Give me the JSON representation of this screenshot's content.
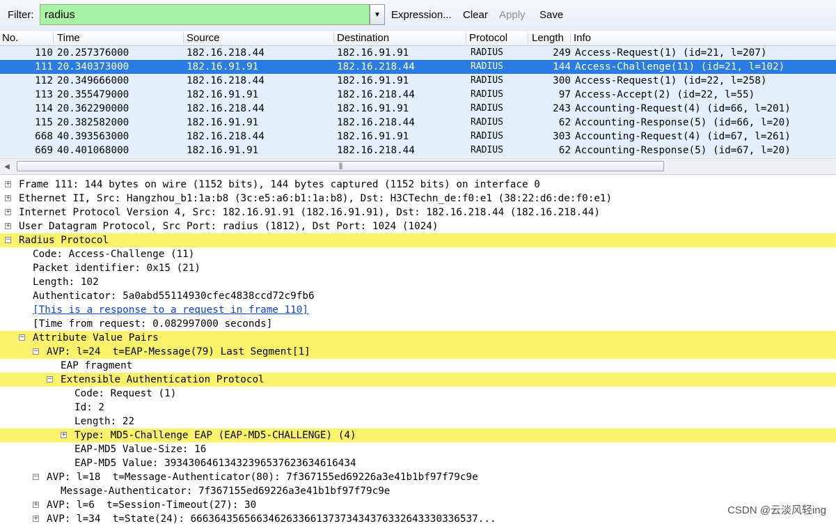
{
  "toolbar": {
    "filter_label": "Filter:",
    "filter_value": "radius",
    "expression_label": "Expression...",
    "clear_label": "Clear",
    "apply_label": "Apply",
    "save_label": "Save"
  },
  "columns": [
    "No.",
    "Time",
    "Source",
    "Destination",
    "Protocol",
    "Length",
    "Info"
  ],
  "packets": [
    {
      "no": "110",
      "time": "20.257376000",
      "src": "182.16.218.44",
      "dst": "182.16.91.91",
      "proto": "RADIUS",
      "len": "249",
      "info": "Access-Request(1) (id=21, l=207)"
    },
    {
      "no": "111",
      "time": "20.340373000",
      "src": "182.16.91.91",
      "dst": "182.16.218.44",
      "proto": "RADIUS",
      "len": "144",
      "info": "Access-Challenge(11) (id=21, l=102)"
    },
    {
      "no": "112",
      "time": "20.349666000",
      "src": "182.16.218.44",
      "dst": "182.16.91.91",
      "proto": "RADIUS",
      "len": "300",
      "info": "Access-Request(1) (id=22, l=258)"
    },
    {
      "no": "113",
      "time": "20.355479000",
      "src": "182.16.91.91",
      "dst": "182.16.218.44",
      "proto": "RADIUS",
      "len": "97",
      "info": "Access-Accept(2) (id=22, l=55)"
    },
    {
      "no": "114",
      "time": "20.362290000",
      "src": "182.16.218.44",
      "dst": "182.16.91.91",
      "proto": "RADIUS",
      "len": "243",
      "info": "Accounting-Request(4) (id=66, l=201)"
    },
    {
      "no": "115",
      "time": "20.382582000",
      "src": "182.16.91.91",
      "dst": "182.16.218.44",
      "proto": "RADIUS",
      "len": "62",
      "info": "Accounting-Response(5) (id=66, l=20)"
    },
    {
      "no": "668",
      "time": "40.393563000",
      "src": "182.16.218.44",
      "dst": "182.16.91.91",
      "proto": "RADIUS",
      "len": "303",
      "info": "Accounting-Request(4) (id=67, l=261)"
    },
    {
      "no": "669",
      "time": "40.401068000",
      "src": "182.16.91.91",
      "dst": "182.16.218.44",
      "proto": "RADIUS",
      "len": "62",
      "info": "Accounting-Response(5) (id=67, l=20)"
    }
  ],
  "selected_packet_no": "111",
  "details": [
    {
      "text": "Frame 111: 144 bytes on wire (1152 bits), 144 bytes captured (1152 bits) on interface 0",
      "toggle": "+"
    },
    {
      "text": "Ethernet II, Src: Hangzhou_b1:1a:b8 (3c:e5:a6:b1:1a:b8), Dst: H3CTechn_de:f0:e1 (38:22:d6:de:f0:e1)",
      "toggle": "+"
    },
    {
      "text": "Internet Protocol Version 4, Src: 182.16.91.91 (182.16.91.91), Dst: 182.16.218.44 (182.16.218.44)",
      "toggle": "+"
    },
    {
      "text": "User Datagram Protocol, Src Port: radius (1812), Dst Port: 1024 (1024)",
      "toggle": "+"
    },
    {
      "text": "Radius Protocol",
      "toggle": "-",
      "highlight": true
    },
    {
      "text": "Code: Access-Challenge (11)",
      "indent": 1
    },
    {
      "text": "Packet identifier: 0x15 (21)",
      "indent": 1
    },
    {
      "text": "Length: 102",
      "indent": 1
    },
    {
      "text": "Authenticator: 5a0abd55114930cfec4838ccd72c9fb6",
      "indent": 1
    },
    {
      "text": "[This is a response to a request in frame 110]",
      "indent": 1,
      "link": true
    },
    {
      "text": "[Time from request: 0.082997000 seconds]",
      "indent": 1
    },
    {
      "text": "Attribute Value Pairs",
      "indent": 1,
      "toggle": "-",
      "highlight": true
    },
    {
      "text": "AVP: l=24  t=EAP-Message(79) Last Segment[1]",
      "indent": 2,
      "toggle": "-",
      "highlight": true
    },
    {
      "text": "EAP fragment",
      "indent": 3
    },
    {
      "text": "Extensible Authentication Protocol",
      "indent": 3,
      "toggle": "-",
      "highlight": true
    },
    {
      "text": "Code: Request (1)",
      "indent": 4
    },
    {
      "text": "Id: 2",
      "indent": 4
    },
    {
      "text": "Length: 22",
      "indent": 4
    },
    {
      "text": "Type: MD5-Challenge EAP (EAP-MD5-CHALLENGE) (4)",
      "indent": 4,
      "toggle": "+",
      "highlight": true
    },
    {
      "text": "EAP-MD5 Value-Size: 16",
      "indent": 4
    },
    {
      "text": "EAP-MD5 Value: 39343064613432396537623634616434",
      "indent": 4
    },
    {
      "text": "AVP: l=18  t=Message-Authenticator(80): 7f367155ed69226a3e41b1bf97f79c9e",
      "indent": 2,
      "toggle": "-"
    },
    {
      "text": "Message-Authenticator: 7f367155ed69226a3e41b1bf97f79c9e",
      "indent": 3
    },
    {
      "text": "AVP: l=6  t=Session-Timeout(27): 30",
      "indent": 2,
      "toggle": "+"
    },
    {
      "text": "AVP: l=34  t=State(24): 666364356566346263366137373434376332643330336537...",
      "indent": 2,
      "toggle": "+"
    }
  ],
  "watermark": "CSDN @云淡风轻ing",
  "icons": {
    "dropdown": "chevron-down-icon",
    "scroll_left": "arrow-left-icon",
    "grip": "grip-icon"
  },
  "colors": {
    "filter_valid": "#a9f3a4",
    "row_bg": "#e3f0fb",
    "selected_row": "#2a7be2",
    "highlight": "#fbf26b",
    "link": "#0b3fe0"
  }
}
